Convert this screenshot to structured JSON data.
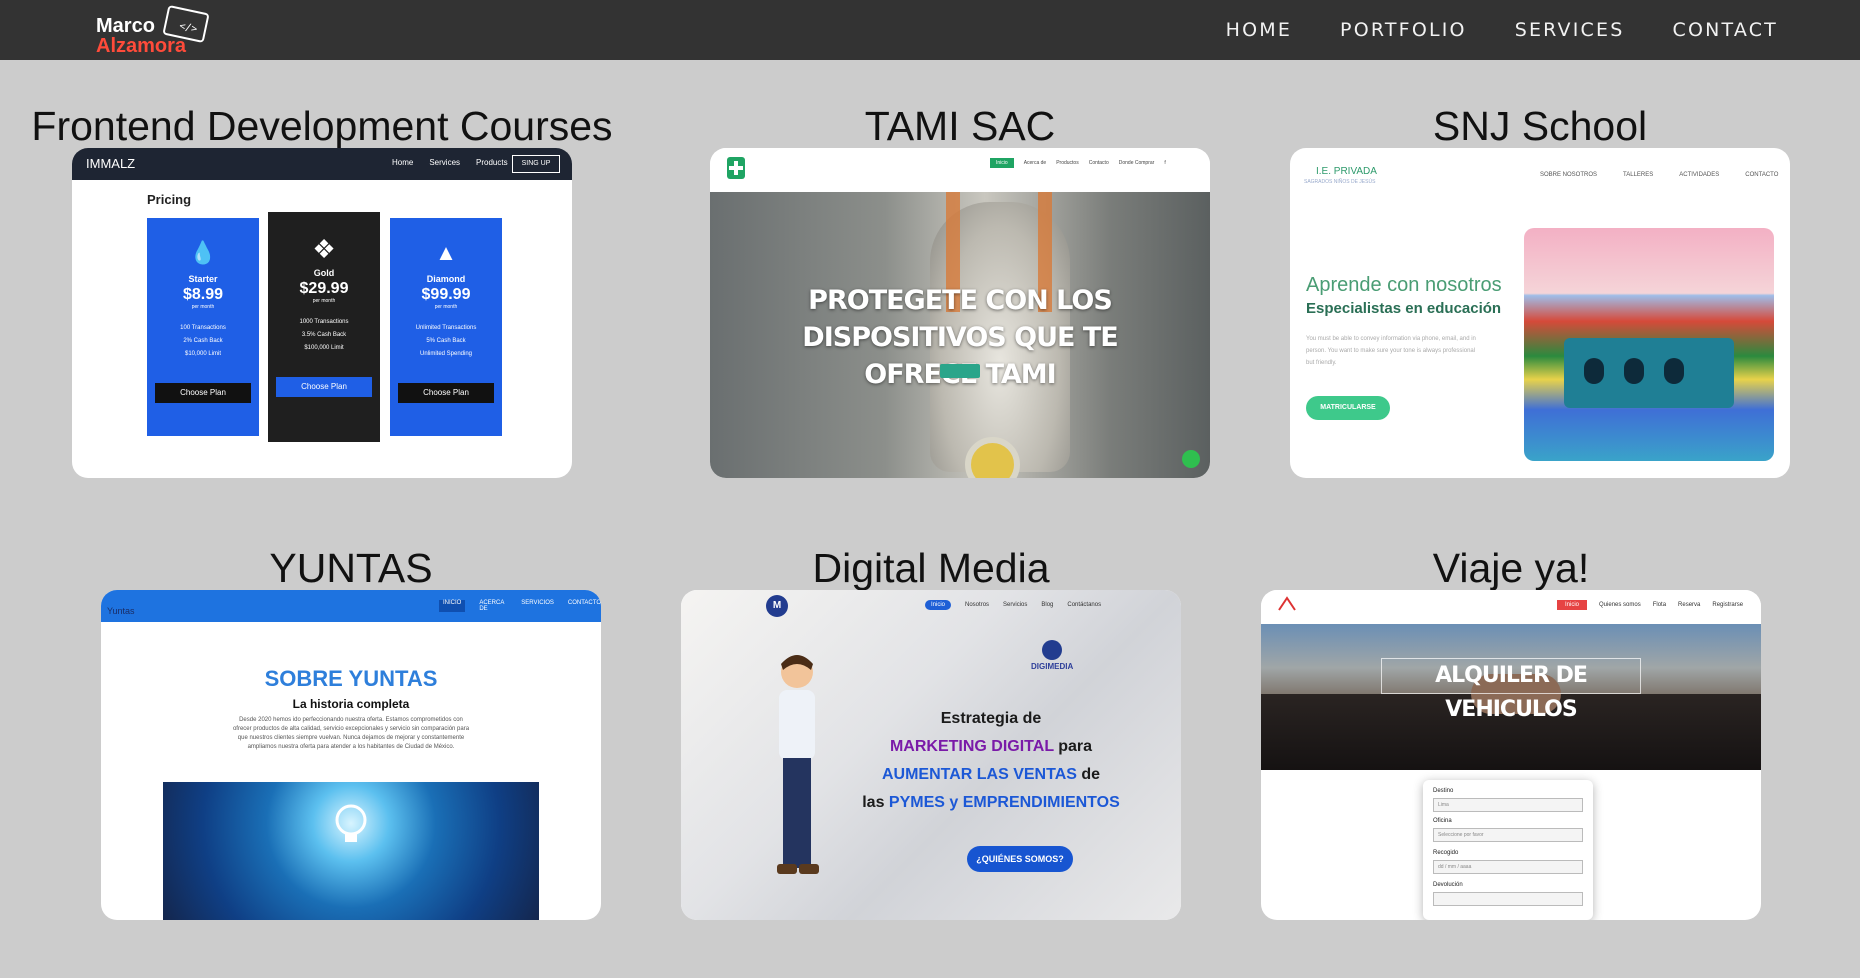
{
  "nav": {
    "logo_line1": "Marco",
    "logo_line2": "Alzamora",
    "links": [
      "HOME",
      "PORTFOLIO",
      "SERVICES",
      "CONTACT"
    ]
  },
  "projects": [
    {
      "title": "Frontend Development Courses",
      "preview": {
        "brand": "IMMALZ",
        "links": [
          "Home",
          "Services",
          "Products"
        ],
        "signup": "SING UP",
        "heading": "Pricing",
        "plans": [
          {
            "name": "Starter",
            "price": "$8.99",
            "period": "per month",
            "features": [
              "100 Transactions",
              "2% Cash Back",
              "$10,000 Limit"
            ],
            "button": "Choose Plan"
          },
          {
            "name": "Gold",
            "price": "$29.99",
            "period": "per month",
            "features": [
              "1000 Transactions",
              "3.5% Cash Back",
              "$100,000 Limit"
            ],
            "button": "Choose Plan"
          },
          {
            "name": "Diamond",
            "price": "$99.99",
            "period": "per month",
            "features": [
              "Unlimited Transactions",
              "5% Cash Back",
              "Unlimited Spending"
            ],
            "button": "Choose Plan"
          }
        ]
      }
    },
    {
      "title": "TAMI SAC",
      "preview": {
        "links": [
          "Inicio",
          "Acerca de",
          "Productos",
          "Contacto",
          "Donde Comprar"
        ],
        "hero_line1": "PROTEGETE CON LOS",
        "hero_line2": "DISPOSITIVOS QUE TE",
        "hero_line3": "OFRECE TAMI"
      }
    },
    {
      "title": "SNJ School",
      "preview": {
        "brand": "I.E. PRIVADA",
        "brand_sub": "SAGRADOS NIÑOS DE JESÚS",
        "links": [
          "SOBRE NOSOTROS",
          "TALLERES",
          "ACTIVIDADES",
          "CONTACTO"
        ],
        "h1": "Aprende con nosotros",
        "h2": "Especialistas en educación",
        "p": "You must be able to convey information via phone, email, and in person. You want to make sure your tone is always professional but friendly.",
        "button": "MATRICULARSE"
      }
    },
    {
      "title": "YUNTAS",
      "preview": {
        "brand": "Yuntas",
        "links": [
          "INICIO",
          "ACERCA DE",
          "SERVICIOS",
          "CONTACTO"
        ],
        "heading": "SOBRE YUNTAS",
        "subheading": "La historia completa",
        "p": "Desde 2020 hemos ido perfeccionando nuestra oferta. Estamos comprometidos con ofrecer productos de alta calidad, servicio excepcionales y servicio sin comparación para que nuestros clientes siempre vuelvan. Nunca dejamos de mejorar y constantemente ampliamos nuestra oferta para atender a los habitantes de Ciudad de México."
      }
    },
    {
      "title": "Digital Media",
      "preview": {
        "links": [
          "Inicio",
          "Nosotros",
          "Servicios",
          "Blog",
          "Contáctanos"
        ],
        "logo2": "DIGIMEDIA",
        "line1": "Estrategia de",
        "line2a": "MARKETING DIGITAL",
        "line2b": " para",
        "line3a": "AUMENTAR LAS VENTAS",
        "line3b": " de",
        "line4a": "las ",
        "line4b": "PYMES y EMPRENDIMIENTOS",
        "button": "¿QUIÉNES SOMOS?"
      }
    },
    {
      "title": "Viaje ya!",
      "preview": {
        "links": [
          "Inicio",
          "Quienes somos",
          "Flota",
          "Reserva",
          "Registrarse"
        ],
        "hero": "ALQUILER DE VEHICULOS",
        "fields": [
          {
            "label": "Destino",
            "value": "Lima"
          },
          {
            "label": "Oficina",
            "value": "Seleccione por favor"
          },
          {
            "label": "Recogido",
            "value": "dd / mm / aaaa"
          },
          {
            "label": "Devolución",
            "value": ""
          }
        ]
      }
    }
  ]
}
